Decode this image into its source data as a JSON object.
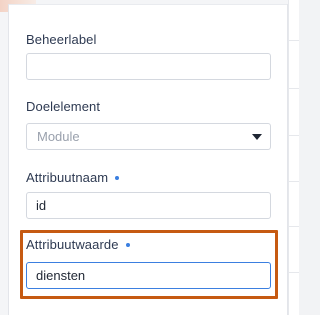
{
  "form": {
    "fields": [
      {
        "label": "Beheerlabel",
        "value": "",
        "placeholder": "",
        "required": false
      },
      {
        "label": "Doelelement",
        "selected": "Module",
        "required": false
      },
      {
        "label": "Attribuutnaam",
        "value": "id",
        "required": true
      },
      {
        "label": "Attribuutwaarde",
        "value": "diensten",
        "required": true
      }
    ]
  },
  "colors": {
    "accent": "#3b7fe0",
    "highlight": "#c65a12",
    "label": "#2e3a52"
  }
}
